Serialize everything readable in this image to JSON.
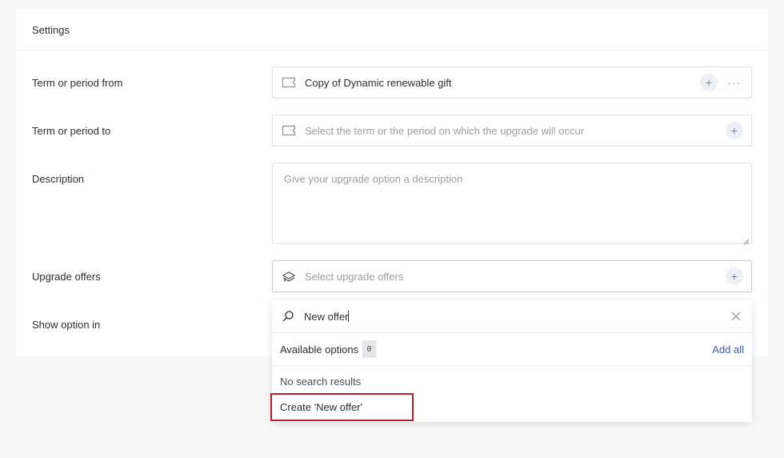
{
  "settings": {
    "title": "Settings",
    "rows": {
      "term_from": {
        "label": "Term or period from",
        "value": "Copy of Dynamic renewable gift",
        "icon": "ticket-icon"
      },
      "term_to": {
        "label": "Term or period to",
        "placeholder": "Select the term or the period on which the upgrade will occur",
        "icon": "ticket-icon"
      },
      "description": {
        "label": "Description",
        "placeholder": "Give your upgrade option a description"
      },
      "upgrade_offers": {
        "label": "Upgrade offers",
        "placeholder": "Select upgrade offers",
        "icon": "offers-stack-icon"
      },
      "show_option_in": {
        "label": "Show option in"
      }
    },
    "buttons": {
      "plus": "+",
      "more": "···"
    }
  },
  "dropdown": {
    "search_value": "New offer",
    "available_label": "Available options",
    "available_count": "0",
    "add_all": "Add all",
    "no_results": "No search results",
    "create_option": "Create 'New offer'"
  },
  "colors": {
    "accent": "#3f5ba9",
    "highlight_border": "#b61f24",
    "plus_bg": "#eef0f6"
  }
}
